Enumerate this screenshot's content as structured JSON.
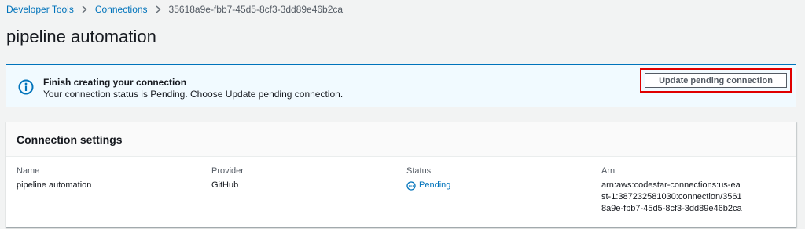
{
  "breadcrumb": {
    "items": [
      "Developer Tools",
      "Connections"
    ],
    "current": "35618a9e-fbb7-45d5-8cf3-3dd89e46b2ca"
  },
  "page": {
    "title": "pipeline automation"
  },
  "alert": {
    "icon": "info-icon",
    "title": "Finish creating your connection",
    "message": "Your connection status is Pending. Choose Update pending connection.",
    "button_label": "Update pending connection"
  },
  "settings": {
    "title": "Connection settings",
    "name_label": "Name",
    "name_value": "pipeline automation",
    "provider_label": "Provider",
    "provider_value": "GitHub",
    "status_label": "Status",
    "status_value": "Pending",
    "status_icon": "pending-icon",
    "arn_label": "Arn",
    "arn_value": "arn:aws:codestar-connections:us-east-1:387232581030:connection/35618a9e-fbb7-45d5-8cf3-3dd89e46b2ca"
  },
  "colors": {
    "link": "#0073bb",
    "alert_border": "#0073bb",
    "alert_bg": "#f1faff",
    "highlight": "#e00000"
  }
}
